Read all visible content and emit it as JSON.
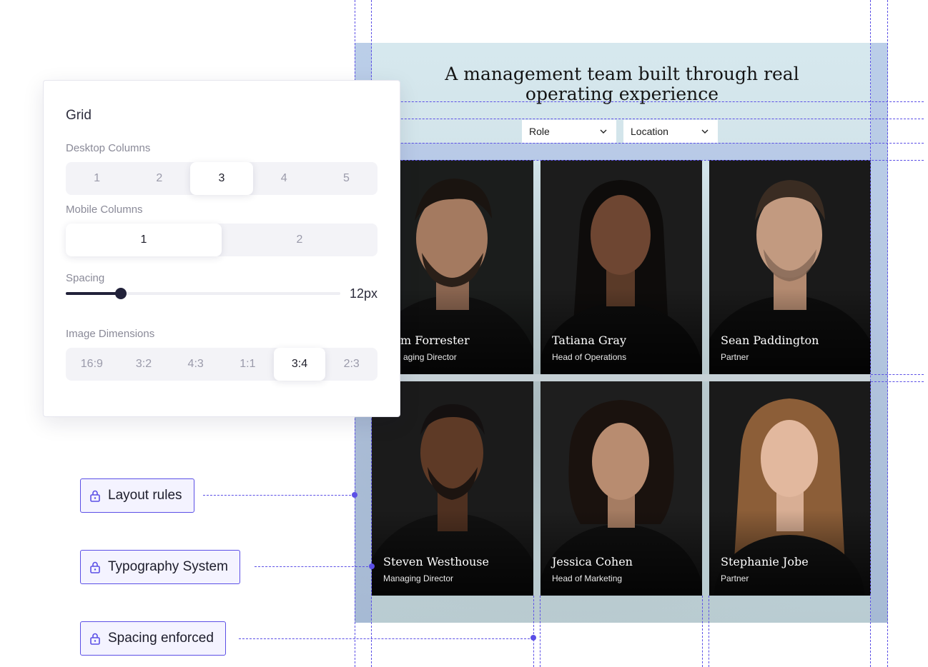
{
  "site": {
    "title": "A management team built through real operating experience",
    "filters": [
      {
        "label": "Role"
      },
      {
        "label": "Location"
      }
    ],
    "team": [
      {
        "name": "Adam Forrester",
        "visible_name": "m Forrester",
        "role": "Managing Director",
        "visible_role": "aging Director"
      },
      {
        "name": "Tatiana Gray",
        "role": "Head of Operations"
      },
      {
        "name": "Sean Paddington",
        "role": "Partner"
      },
      {
        "name": "Steven Westhouse",
        "role": "Managing Director"
      },
      {
        "name": "Jessica Cohen",
        "role": "Head of Marketing"
      },
      {
        "name": "Stephanie Jobe",
        "role": "Partner"
      }
    ]
  },
  "panel": {
    "title": "Grid",
    "desktop_columns": {
      "label": "Desktop Columns",
      "options": [
        "1",
        "2",
        "3",
        "4",
        "5"
      ],
      "selected": "3"
    },
    "mobile_columns": {
      "label": "Mobile Columns",
      "options": [
        "1",
        "2"
      ],
      "selected": "1"
    },
    "spacing": {
      "label": "Spacing",
      "value": "12px",
      "fraction": 0.2
    },
    "image_dimensions": {
      "label": "Image Dimensions",
      "options": [
        "16:9",
        "3:2",
        "4:3",
        "1:1",
        "3:4",
        "2:3"
      ],
      "selected": "3:4"
    }
  },
  "badges": [
    {
      "label": "Layout rules",
      "icon": "lock-icon"
    },
    {
      "label": "Typography System",
      "icon": "lock-icon"
    },
    {
      "label": "Spacing enforced",
      "icon": "lock-icon"
    }
  ],
  "colors": {
    "accent": "#5b4fe6",
    "guide_band": "#8c96dc",
    "panel_selected": "#ffffff"
  }
}
